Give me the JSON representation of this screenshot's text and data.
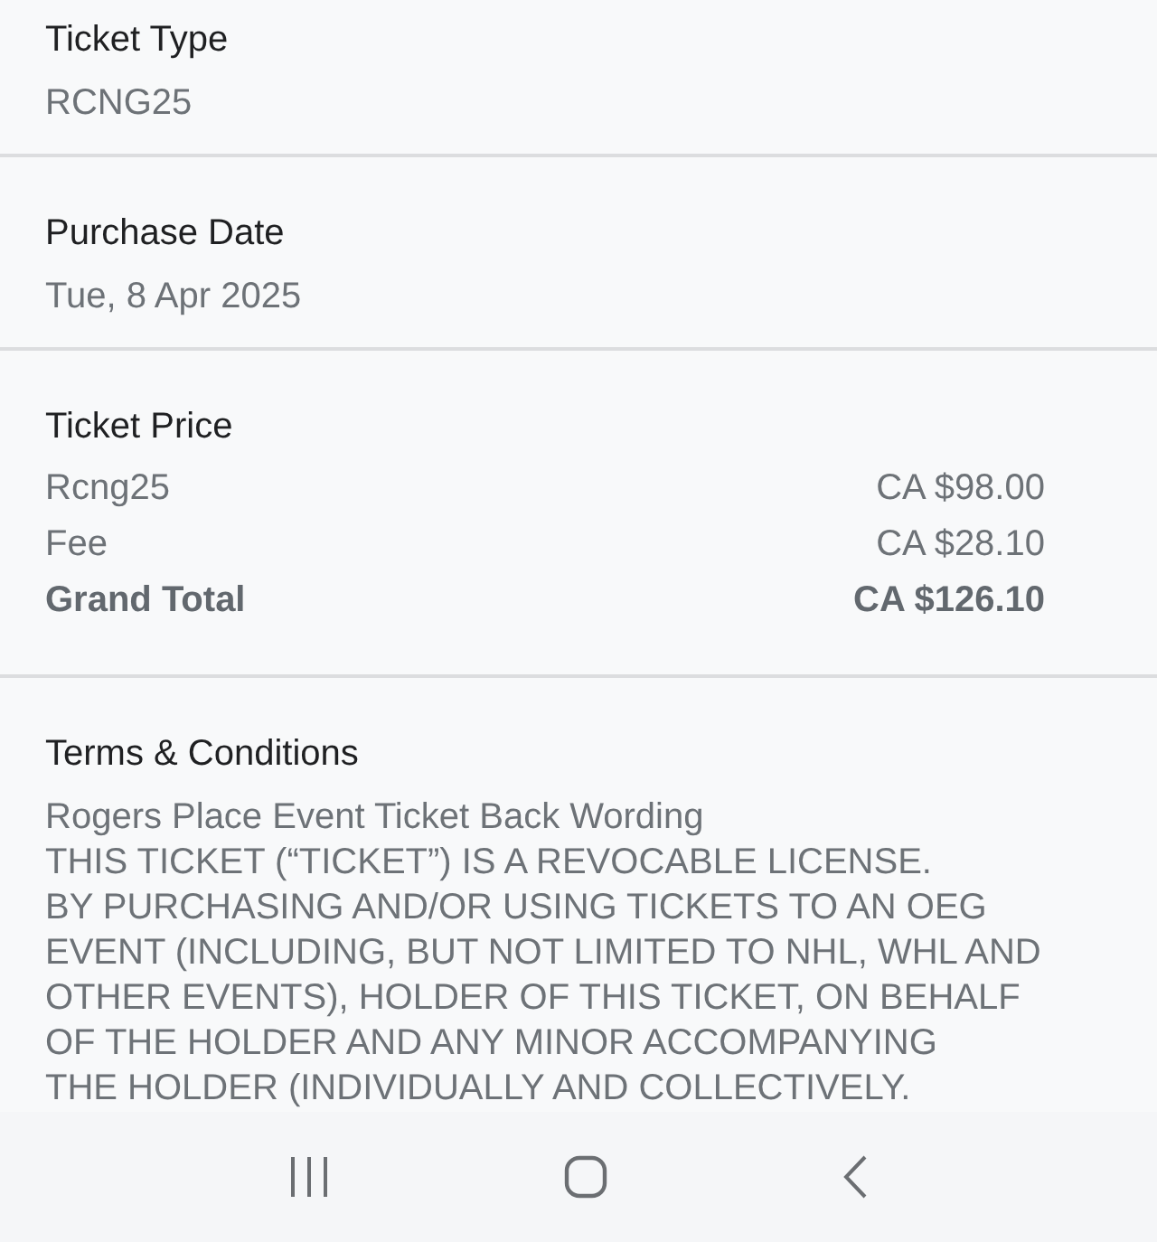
{
  "sections": [
    {
      "kind": "field",
      "label": "Ticket Type",
      "value": "RCNG25"
    },
    {
      "kind": "field",
      "label": "Purchase Date",
      "value": "Tue, 8 Apr 2025"
    },
    {
      "kind": "price",
      "label": "Ticket Price",
      "rows": [
        {
          "name": "Rcng25",
          "amount": "CA $98.00",
          "total": false
        },
        {
          "name": "Fee",
          "amount": "CA $28.10",
          "total": false
        },
        {
          "name": "Grand Total",
          "amount": "CA $126.10",
          "total": true
        }
      ]
    },
    {
      "kind": "text",
      "label": "Terms & Conditions",
      "text": "Rogers Place Event Ticket Back Wording\nTHIS TICKET (“TICKET”) IS A REVOCABLE LICENSE.\nBY PURCHASING AND/OR USING TICKETS TO AN OEG\nEVENT (INCLUDING, BUT NOT LIMITED TO NHL, WHL AND\nOTHER EVENTS), HOLDER OF THIS TICKET, ON BEHALF\nOF THE HOLDER AND ANY MINOR ACCOMPANYING\nTHE HOLDER (INDIVIDUALLY AND COLLECTIVELY."
    }
  ]
}
